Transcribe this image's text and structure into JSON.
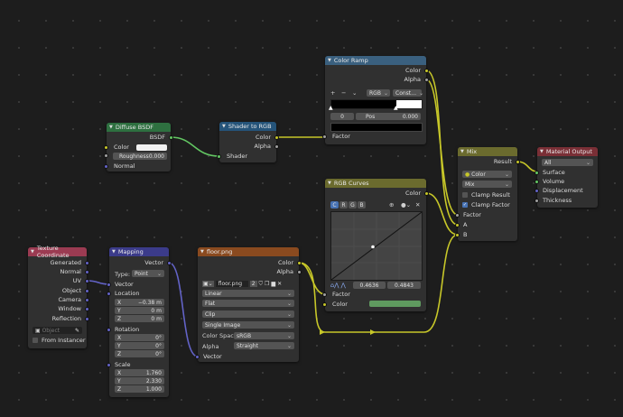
{
  "nodes": {
    "diffuse": {
      "title": "Diffuse BSDF",
      "out_bsdf": "BSDF",
      "in_color": "Color",
      "roughness_label": "Roughness",
      "roughness_value": "0.000",
      "in_normal": "Normal",
      "header_color": "#2e7040"
    },
    "shader_rgb": {
      "title": "Shader to RGB",
      "out_color": "Color",
      "out_alpha": "Alpha",
      "in_shader": "Shader",
      "header_color": "#25547a"
    },
    "color_ramp": {
      "title": "Color Ramp",
      "out_color": "Color",
      "out_alpha": "Alpha",
      "btn_add": "+",
      "btn_remove": "−",
      "mode": "RGB",
      "interp": "Const…",
      "stop_index": "0",
      "pos_label": "Pos",
      "pos_value": "0.000",
      "in_factor": "Factor",
      "header_color": "#3a607f"
    },
    "rgb_curves": {
      "title": "RGB Curves",
      "out_color": "Color",
      "tabs": [
        "C",
        "R",
        "G",
        "B"
      ],
      "pt_x": "0.4636",
      "pt_y": "0.4843",
      "in_factor": "Factor",
      "in_color": "Color",
      "swatch": "#5f9a5f",
      "header_color": "#6b6b2e"
    },
    "mix": {
      "title": "Mix",
      "out_result": "Result",
      "data_type": "Color",
      "blend_mode": "Mix",
      "clamp_result": "Clamp Result",
      "clamp_factor": "Clamp Factor",
      "in_factor": "Factor",
      "in_a": "A",
      "in_b": "B",
      "header_color": "#6b6b2e"
    },
    "material_output": {
      "title": "Material Output",
      "target": "All",
      "in_surface": "Surface",
      "in_volume": "Volume",
      "in_displacement": "Displacement",
      "in_thickness": "Thickness",
      "header_color": "#7a2f36"
    },
    "texcoord": {
      "title": "Texture Coordinate",
      "outputs": [
        "Generated",
        "Normal",
        "UV",
        "Object",
        "Camera",
        "Window",
        "Reflection"
      ],
      "object_placeholder": "Object",
      "from_instancer": "From Instancer",
      "header_color": "#9b3b52"
    },
    "mapping": {
      "title": "Mapping",
      "out_vector": "Vector",
      "type_label": "Type:",
      "type_value": "Point",
      "in_vector": "Vector",
      "location_label": "Location",
      "location": [
        {
          "axis": "X",
          "value": "−0.38 m"
        },
        {
          "axis": "Y",
          "value": "0 m"
        },
        {
          "axis": "Z",
          "value": "0 m"
        }
      ],
      "rotation_label": "Rotation",
      "rotation": [
        {
          "axis": "X",
          "value": "0°"
        },
        {
          "axis": "Y",
          "value": "0°"
        },
        {
          "axis": "Z",
          "value": "0°"
        }
      ],
      "scale_label": "Scale",
      "scale": [
        {
          "axis": "X",
          "value": "1.760"
        },
        {
          "axis": "Y",
          "value": "2.330"
        },
        {
          "axis": "Z",
          "value": "1.000"
        }
      ],
      "header_color": "#3b3b8a"
    },
    "image": {
      "title": "floor.png",
      "out_color": "Color",
      "out_alpha": "Alpha",
      "image_name": "floor.png",
      "users": "2",
      "interpolation": "Linear",
      "projection": "Flat",
      "extension": "Clip",
      "source": "Single Image",
      "color_space_label": "Color Space",
      "color_space": "sRGB",
      "alpha_label": "Alpha",
      "alpha_mode": "Straight",
      "in_vector": "Vector",
      "header_color": "#8a4a1f"
    }
  }
}
